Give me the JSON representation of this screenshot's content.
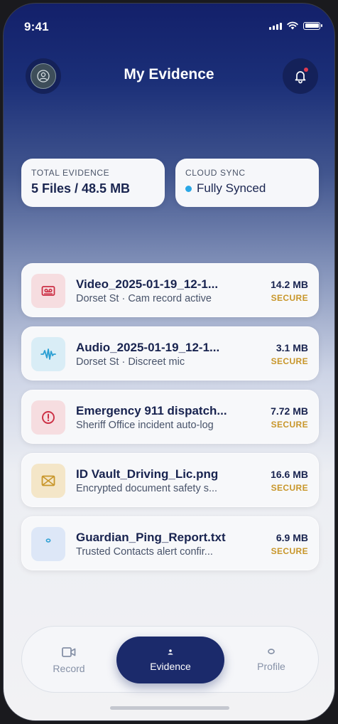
{
  "status_bar": {
    "time": "9:41"
  },
  "header": {
    "title": "My Evidence"
  },
  "stats": {
    "total": {
      "label": "TOTAL EVIDENCE",
      "value": "5 Files / 48.5 MB"
    },
    "sync": {
      "label": "CLOUD SYNC",
      "value": "Fully Synced"
    }
  },
  "files": [
    {
      "name": "Video_2025-01-19_12-1...",
      "subtitle": "Dorset St · Cam record active",
      "size": "14.2 MB",
      "status": "SECURE",
      "icon": "video-cassette-icon"
    },
    {
      "name": "Audio_2025-01-19_12-1...",
      "subtitle": "Dorset St · Discreet mic",
      "size": "3.1 MB",
      "status": "SECURE",
      "icon": "audio-wave-icon"
    },
    {
      "name": "Emergency 911 dispatch...",
      "subtitle": "Sheriff Office incident auto-log",
      "size": "7.72 MB",
      "status": "SECURE",
      "icon": "alert-circle-icon"
    },
    {
      "name": "ID Vault_Driving_Lic.png",
      "subtitle": "Encrypted document safety s...",
      "size": "16.6 MB",
      "status": "SECURE",
      "icon": "id-card-icon"
    },
    {
      "name": "Guardian_Ping_Report.txt",
      "subtitle": "Trusted Contacts alert confir...",
      "size": "6.9 MB",
      "status": "SECURE",
      "icon": "ping-icon"
    }
  ],
  "nav": {
    "record": "Record",
    "evidence": "Evidence",
    "profile": "Profile"
  },
  "colors": {
    "accent": "#1b2a6b",
    "secure": "#c8962a",
    "sync_dot": "#2aa7e6"
  }
}
